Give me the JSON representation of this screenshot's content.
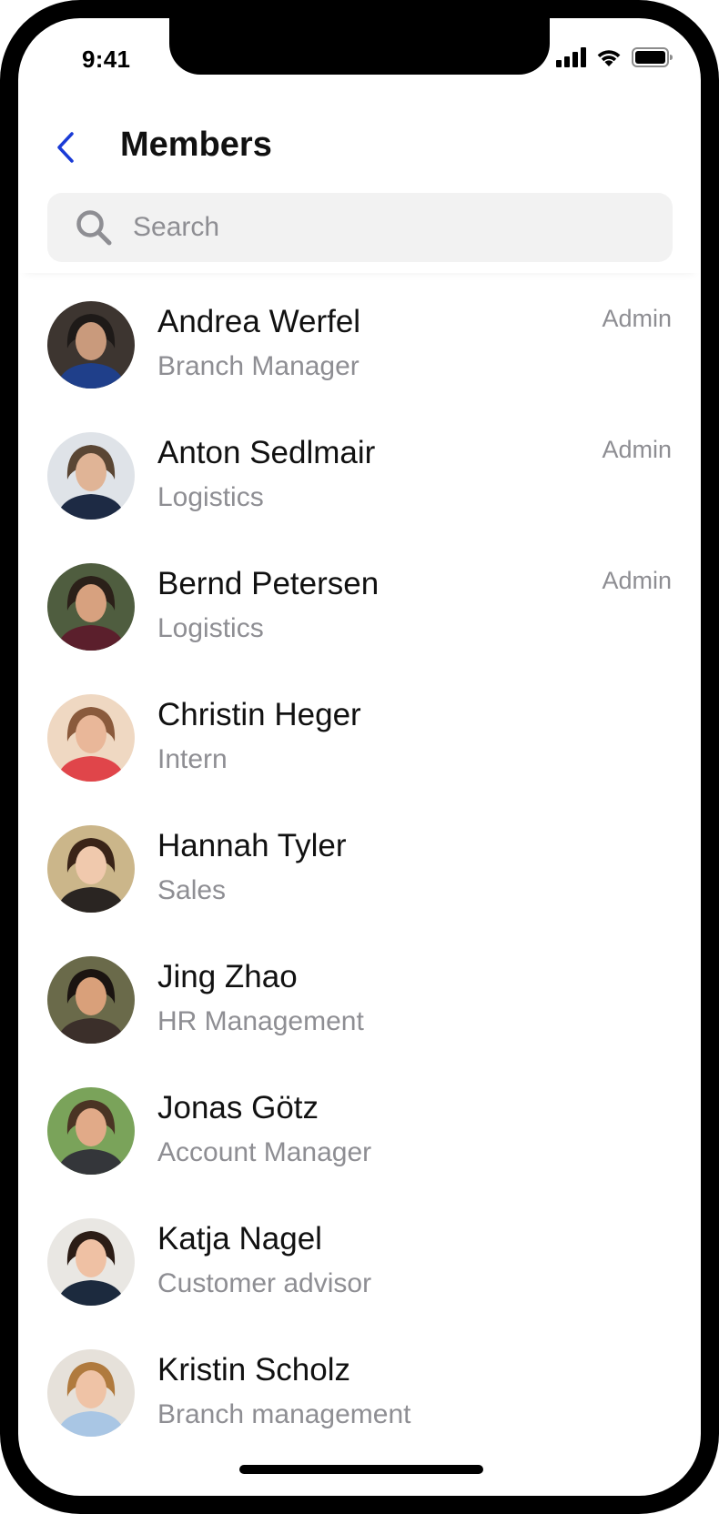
{
  "status_bar": {
    "time": "9:41",
    "icons": [
      "cellular-signal-icon",
      "wifi-icon",
      "battery-icon"
    ]
  },
  "header": {
    "back_icon": "chevron-left-icon",
    "title": "Members",
    "accent_color": "#1a3bd6"
  },
  "search": {
    "icon": "search-icon",
    "placeholder": "Search",
    "value": ""
  },
  "members": [
    {
      "name": "Andrea Werfel",
      "role": "Branch Manager",
      "badge": "Admin",
      "avatar": {
        "bg": "#3d3530",
        "skin": "#c99a7c",
        "hair": "#1e1a18",
        "clothes": "#1f3f8a"
      }
    },
    {
      "name": "Anton Sedlmair",
      "role": "Logistics",
      "badge": "Admin",
      "avatar": {
        "bg": "#dfe3e8",
        "skin": "#e0b496",
        "hair": "#5a4634",
        "clothes": "#1d2a44"
      }
    },
    {
      "name": "Bernd Petersen",
      "role": "Logistics",
      "badge": "Admin",
      "avatar": {
        "bg": "#4f5d3f",
        "skin": "#d7a17f",
        "hair": "#2b2019",
        "clothes": "#5b1f2c"
      }
    },
    {
      "name": "Christin Heger",
      "role": "Intern",
      "badge": "",
      "avatar": {
        "bg": "#efd8c2",
        "skin": "#e9b799",
        "hair": "#8a5a3c",
        "clothes": "#e0454a"
      }
    },
    {
      "name": "Hannah Tyler",
      "role": "Sales",
      "badge": "",
      "avatar": {
        "bg": "#cbb68a",
        "skin": "#f0c9ad",
        "hair": "#3a2418",
        "clothes": "#2a2522"
      }
    },
    {
      "name": "Jing Zhao",
      "role": "HR Management",
      "badge": "",
      "avatar": {
        "bg": "#6a6a4a",
        "skin": "#d9a07a",
        "hair": "#1b1411",
        "clothes": "#3b2f2a"
      }
    },
    {
      "name": "Jonas Götz",
      "role": "Account Manager",
      "badge": "",
      "avatar": {
        "bg": "#7aa35a",
        "skin": "#e1aa88",
        "hair": "#4a3424",
        "clothes": "#34363a"
      }
    },
    {
      "name": "Katja Nagel",
      "role": "Customer advisor",
      "badge": "",
      "avatar": {
        "bg": "#e9e7e3",
        "skin": "#efc1a4",
        "hair": "#2c1d16",
        "clothes": "#1c2a3e"
      }
    },
    {
      "name": "Kristin Scholz",
      "role": "Branch management",
      "badge": "",
      "avatar": {
        "bg": "#e6e1da",
        "skin": "#efc3a6",
        "hair": "#b07a3e",
        "clothes": "#a9c6e4"
      }
    }
  ]
}
